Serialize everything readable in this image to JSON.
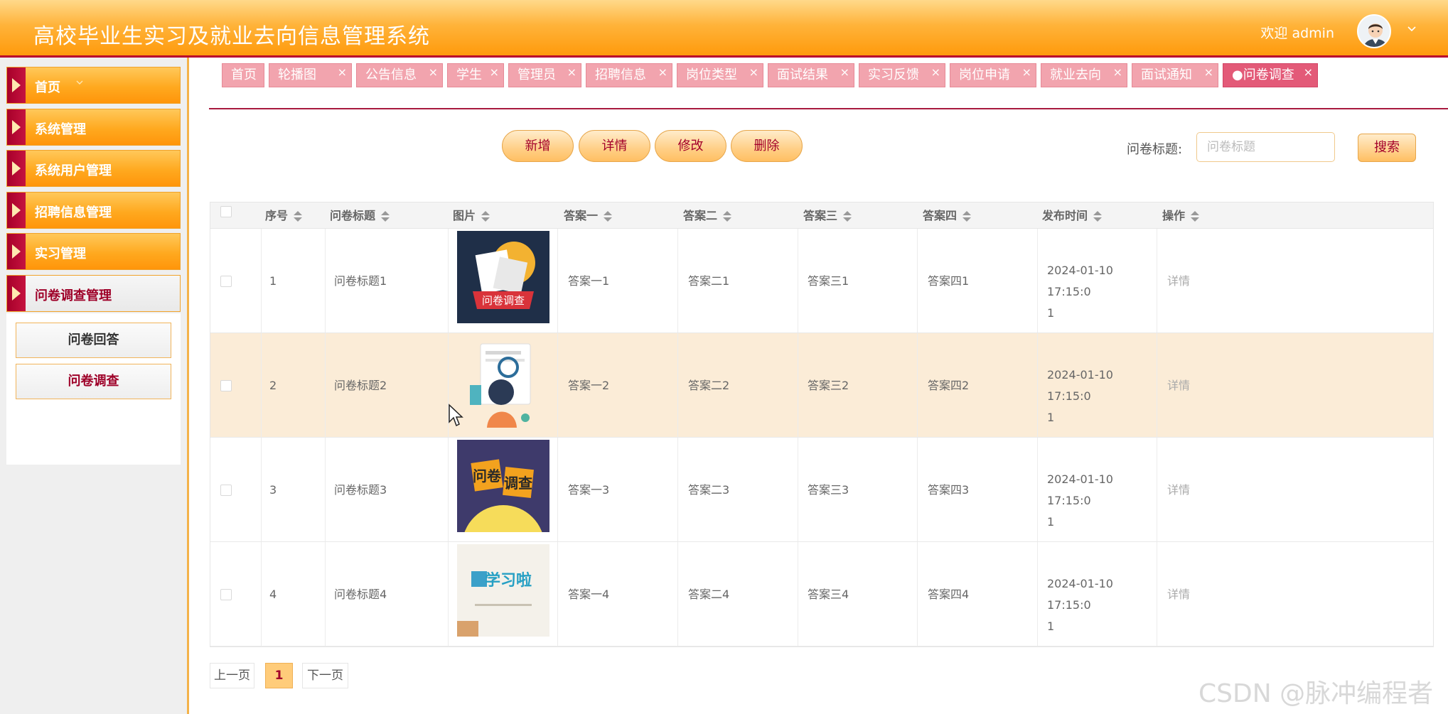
{
  "header": {
    "title": "高校毕业生实习及就业去向信息管理系统",
    "welcome": "欢迎 admin"
  },
  "sidebar": {
    "items": [
      {
        "label": "首页"
      },
      {
        "label": "系统管理"
      },
      {
        "label": "系统用户管理"
      },
      {
        "label": "招聘信息管理"
      },
      {
        "label": "实习管理"
      },
      {
        "label": "问卷调查管理"
      }
    ],
    "subitems": [
      {
        "label": "问卷回答"
      },
      {
        "label": "问卷调查"
      }
    ]
  },
  "tabs": [
    {
      "label": "首页"
    },
    {
      "label": "轮播图"
    },
    {
      "label": "公告信息"
    },
    {
      "label": "学生"
    },
    {
      "label": "管理员"
    },
    {
      "label": "招聘信息"
    },
    {
      "label": "岗位类型"
    },
    {
      "label": "面试结果"
    },
    {
      "label": "实习反馈"
    },
    {
      "label": "岗位申请"
    },
    {
      "label": "就业去向"
    },
    {
      "label": "面试通知"
    },
    {
      "label": "●问卷调查"
    }
  ],
  "toolbar": {
    "add": "新增",
    "detail": "详情",
    "edit": "修改",
    "delete": "删除",
    "search_label": "问卷标题:",
    "search_placeholder": "问卷标题",
    "search_button": "搜索"
  },
  "table": {
    "columns": [
      "序号",
      "问卷标题",
      "图片",
      "答案一",
      "答案二",
      "答案三",
      "答案四",
      "发布时间",
      "操作"
    ],
    "rows": [
      {
        "no": "1",
        "title": "问卷标题1",
        "a1": "答案一1",
        "a2": "答案二1",
        "a3": "答案三1",
        "a4": "答案四1",
        "time1": "2024-01-10 17:15:0",
        "time2": "1",
        "op": "详情",
        "img_text": "问卷调查"
      },
      {
        "no": "2",
        "title": "问卷标题2",
        "a1": "答案一2",
        "a2": "答案二2",
        "a3": "答案三2",
        "a4": "答案四2",
        "time1": "2024-01-10 17:15:0",
        "time2": "1",
        "op": "详情",
        "img_text": ""
      },
      {
        "no": "3",
        "title": "问卷标题3",
        "a1": "答案一3",
        "a2": "答案二3",
        "a3": "答案三3",
        "a4": "答案四3",
        "time1": "2024-01-10 17:15:0",
        "time2": "1",
        "op": "详情",
        "img_text": "问卷调查"
      },
      {
        "no": "4",
        "title": "问卷标题4",
        "a1": "答案一4",
        "a2": "答案二4",
        "a3": "答案三4",
        "a4": "答案四4",
        "time1": "2024-01-10 17:15:0",
        "time2": "1",
        "op": "详情",
        "img_text": "学习啦"
      }
    ]
  },
  "pagination": {
    "prev": "上一页",
    "current": "1",
    "next": "下一页"
  },
  "watermark": "CSDN @脉冲编程者",
  "colors": {
    "brand_orange": "#ffa91f",
    "brand_red": "#a8193e",
    "tab_pink": "#f2a4ae",
    "row_highlight": "#fbecd7"
  }
}
